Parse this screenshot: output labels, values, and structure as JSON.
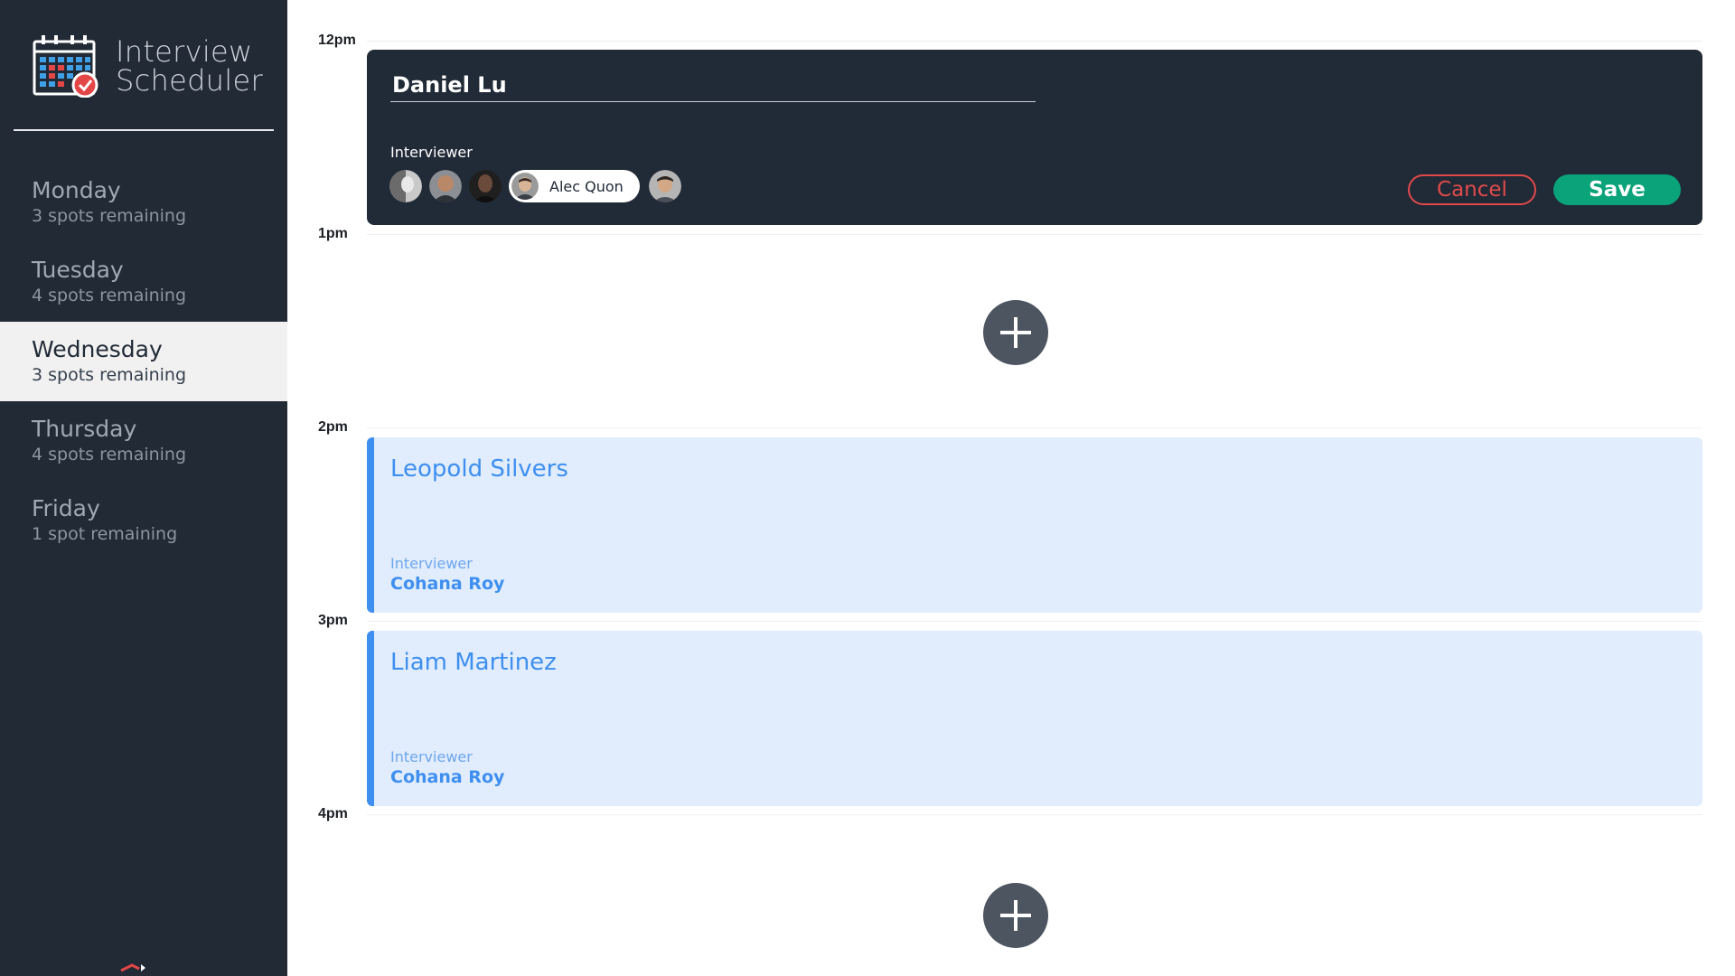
{
  "app": {
    "title_line1": "Interview",
    "title_line2": "Scheduler"
  },
  "days": [
    {
      "name": "Monday",
      "spots": "3 spots remaining",
      "selected": false
    },
    {
      "name": "Tuesday",
      "spots": "4 spots remaining",
      "selected": false
    },
    {
      "name": "Wednesday",
      "spots": "3 spots remaining",
      "selected": true
    },
    {
      "name": "Thursday",
      "spots": "4 spots remaining",
      "selected": false
    },
    {
      "name": "Friday",
      "spots": "1 spot remaining",
      "selected": false
    }
  ],
  "times": [
    "12pm",
    "1pm",
    "2pm",
    "3pm",
    "4pm"
  ],
  "form": {
    "student_name": "Daniel Lu",
    "interviewer_label": "Interviewer",
    "selected_interviewer": "Alec Quon",
    "cancel_label": "Cancel",
    "save_label": "Save"
  },
  "appointments": [
    {
      "student": "Leopold Silvers",
      "interviewer_label": "Interviewer",
      "interviewer": "Cohana Roy"
    },
    {
      "student": "Liam Martinez",
      "interviewer_label": "Interviewer",
      "interviewer": "Cohana Roy"
    }
  ],
  "colors": {
    "sidebar_bg": "#222a36",
    "form_bg": "#212a37",
    "save_green": "#0aa37a",
    "cancel_red": "#e04a4a",
    "appointment_bg": "#e1edfc",
    "appointment_accent": "#3e8ff0",
    "add_button": "#4d5561"
  },
  "icons": {
    "logo": "calendar-check-icon",
    "add": "plus-icon"
  }
}
